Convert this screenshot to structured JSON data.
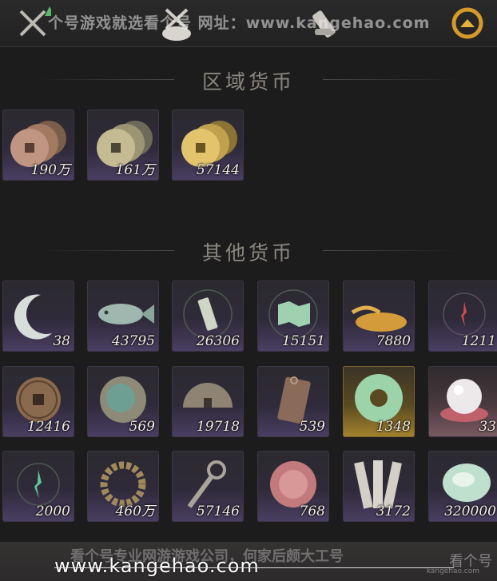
{
  "header": {
    "watermark": "个号游戏就选看个号 网址：www.kangehao.com"
  },
  "sections": [
    {
      "title": "区域货币",
      "items": [
        {
          "icon": "copper-coins-icon",
          "count": "190万"
        },
        {
          "icon": "silver-coins-icon",
          "count": "161万"
        },
        {
          "icon": "gold-coins-icon",
          "count": "57144"
        }
      ]
    },
    {
      "title": "其他货币",
      "items": [
        {
          "icon": "jade-crescent-icon",
          "count": "38"
        },
        {
          "icon": "jade-fish-icon",
          "count": "43795"
        },
        {
          "icon": "token-icon",
          "count": "26306"
        },
        {
          "icon": "map-icon",
          "count": "15151"
        },
        {
          "icon": "grain-pile-icon",
          "count": "7880"
        },
        {
          "icon": "red-spirit-icon",
          "count": "1211"
        },
        {
          "icon": "bronze-coin-icon",
          "count": "12416"
        },
        {
          "icon": "stone-disc-icon",
          "count": "569"
        },
        {
          "icon": "half-coin-icon",
          "count": "19718"
        },
        {
          "icon": "bronze-plaque-icon",
          "count": "539"
        },
        {
          "icon": "jade-ring-icon",
          "count": "1348"
        },
        {
          "icon": "pearl-icon",
          "count": "33"
        },
        {
          "icon": "green-spirit-icon",
          "count": "2000"
        },
        {
          "icon": "coin-string-icon",
          "count": "460万"
        },
        {
          "icon": "coin-sword-icon",
          "count": "57146"
        },
        {
          "icon": "pink-stone-icon",
          "count": "768"
        },
        {
          "icon": "bamboo-slips-icon",
          "count": "3172"
        },
        {
          "icon": "jade-stone-icon",
          "count": "320000"
        }
      ]
    }
  ],
  "footer": {
    "watermark": "看个号专业网游游戏公司，何家后颇大工号",
    "url": "www.kangehao.com",
    "logo": "看个号",
    "logo_sub": "kangehao.com"
  }
}
